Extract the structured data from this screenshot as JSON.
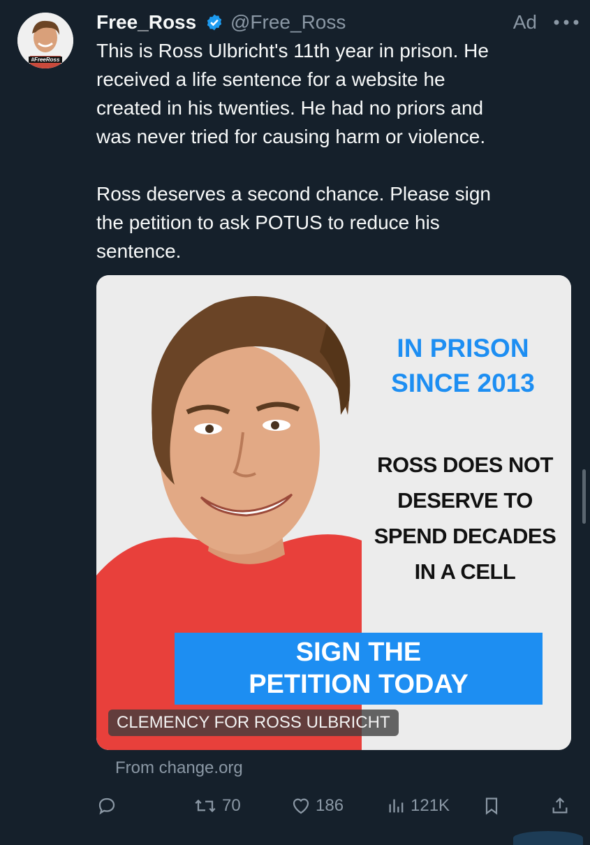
{
  "account": {
    "display_name": "Free_Ross",
    "handle": "@Free_Ross",
    "ad_label": "Ad",
    "avatar_caption": "#FreeRoss"
  },
  "tweet": {
    "paragraph_1": "This is Ross Ulbricht's 11th year in prison. He\nreceived a life sentence for a website he\ncreated in his twenties. He had no priors and\nwas never tried for causing harm or violence.",
    "paragraph_2": "Ross deserves a second chance. Please sign\nthe petition to ask POTUS to reduce his\nsentence."
  },
  "card": {
    "headline_blue": "IN PRISON\nSINCE 2013",
    "headline_black": "ROSS DOES NOT\nDESERVE TO\nSPEND DECADES\nIN A CELL",
    "cta": "SIGN THE\nPETITION TODAY",
    "caption": "CLEMENCY FOR ROSS ULBRICHT",
    "source": "From change.org"
  },
  "actions": {
    "reply_icon": "reply-icon",
    "retweet_count": "70",
    "like_count": "186",
    "views_count": "121K"
  },
  "colors": {
    "background": "#15202b",
    "accent_blue": "#1d8ef2",
    "muted_text": "#8b98a5",
    "verified_blue": "#1d9bf0"
  }
}
